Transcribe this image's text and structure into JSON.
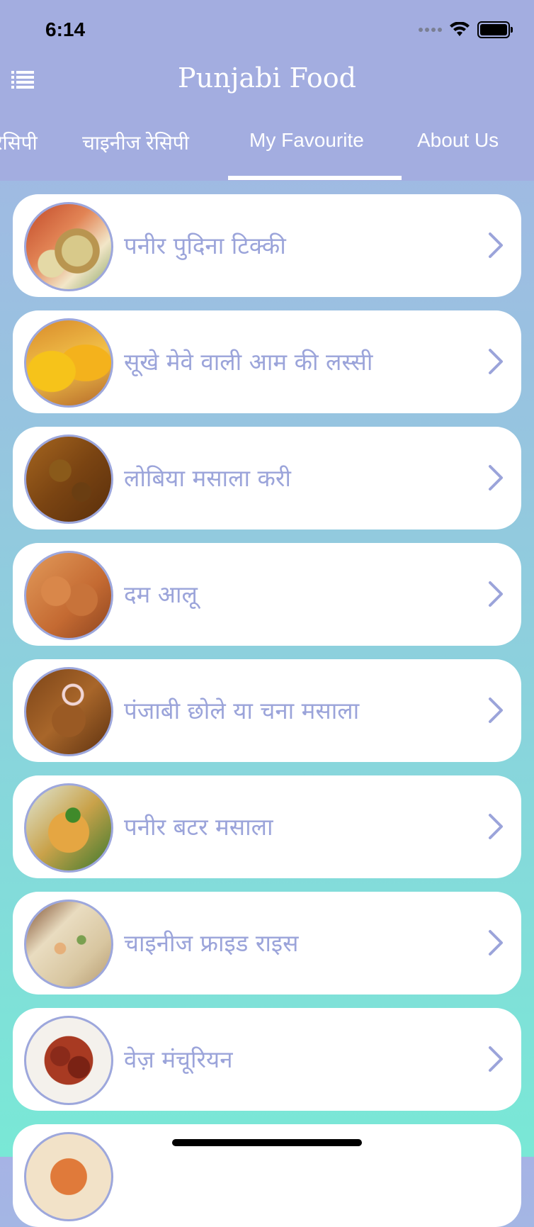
{
  "status_bar": {
    "time": "6:14"
  },
  "header": {
    "title": "Punjabi Food"
  },
  "tabs": [
    {
      "label": "रेसिपी",
      "active": false
    },
    {
      "label": "चाइनीज रेसिपी",
      "active": false
    },
    {
      "label": "My Favourite",
      "active": true
    },
    {
      "label": "About Us",
      "active": false
    }
  ],
  "favourites": [
    {
      "label": "पनीर पुदिना टिक्की",
      "icon": "paneer-tikki-thumbnail"
    },
    {
      "label": "सूखे मेवे वाली आम की लस्सी",
      "icon": "mango-lassi-thumbnail"
    },
    {
      "label": "लोबिया मसाला करी",
      "icon": "lobia-curry-thumbnail"
    },
    {
      "label": "दम आलू",
      "icon": "dum-aloo-thumbnail"
    },
    {
      "label": "पंजाबी छोले या चना मसाला",
      "icon": "chole-thumbnail"
    },
    {
      "label": "पनीर बटर मसाला",
      "icon": "paneer-butter-masala-thumbnail"
    },
    {
      "label": "चाइनीज फ्राइड राइस",
      "icon": "fried-rice-thumbnail"
    },
    {
      "label": "वेज़ मंचूरियन",
      "icon": "veg-manchurian-thumbnail"
    },
    {
      "label": "",
      "icon": "food-thumbnail"
    }
  ],
  "colors": {
    "header_bg": "#a3ade0",
    "accent_text": "#9ba4da",
    "card_bg": "#ffffff"
  }
}
